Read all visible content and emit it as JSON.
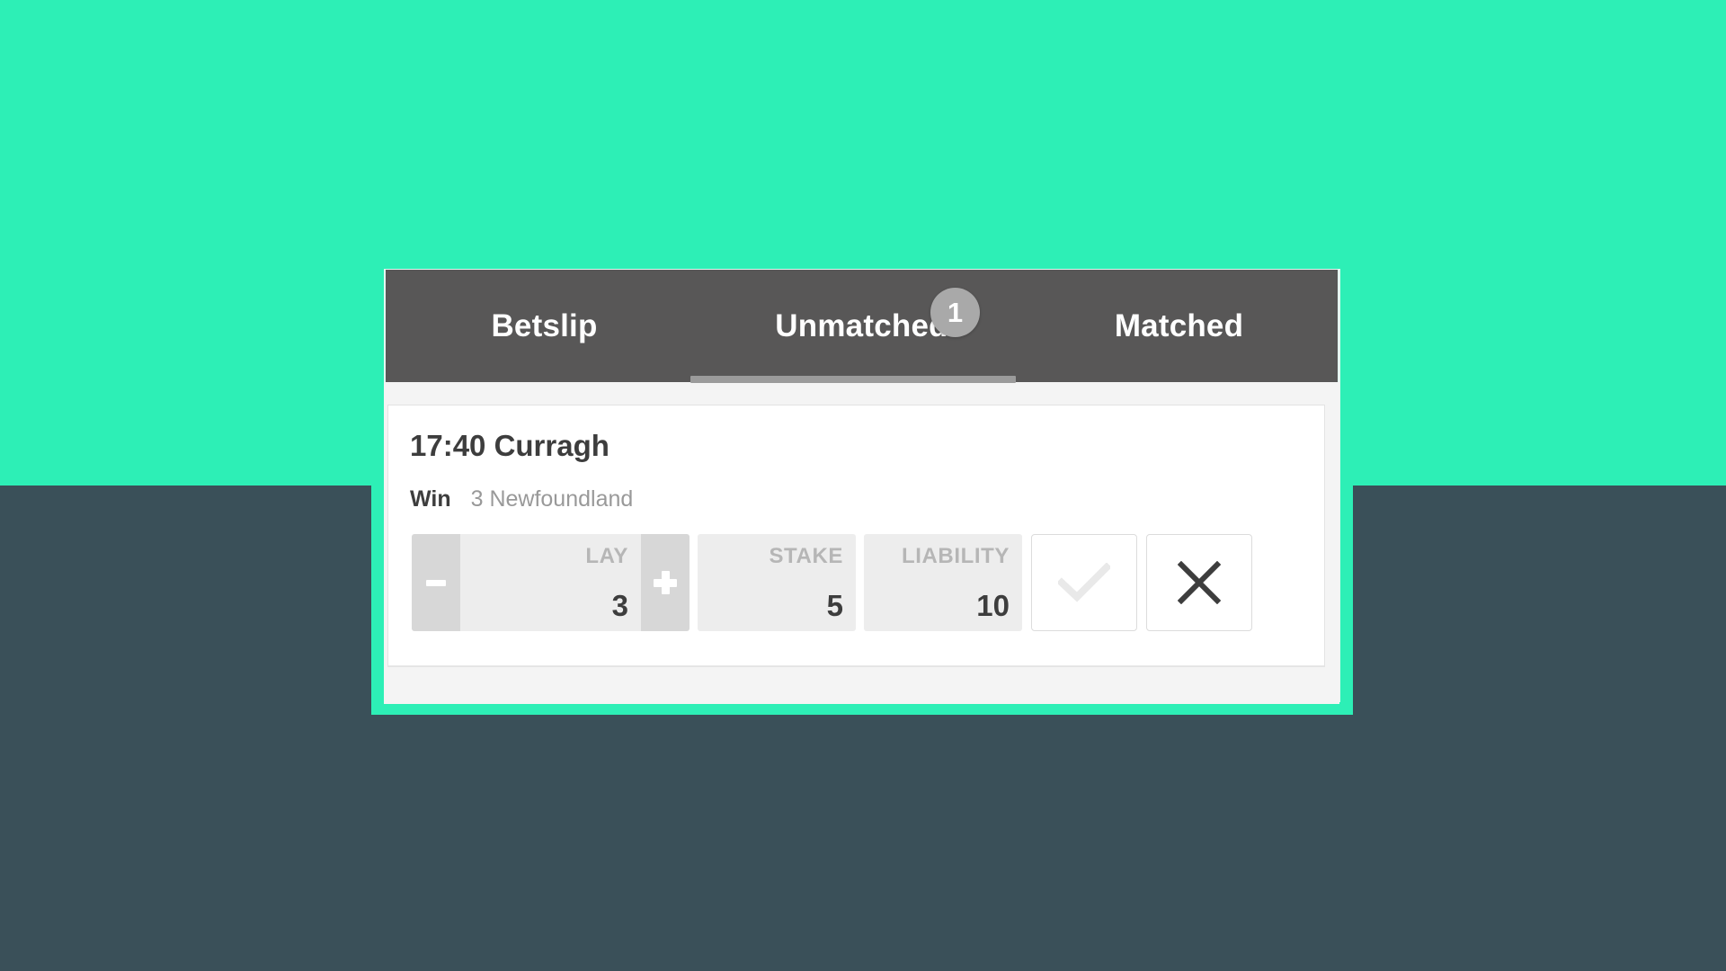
{
  "theme": {
    "background_top": "#2defb6",
    "background_bottom": "#3a5059",
    "frame_accent": "#2defb6",
    "tabbar_background": "#585757",
    "badge_background": "#a9a9a9",
    "value_text": "#3d3d3d",
    "label_text": "#b6b6b6",
    "muted_text": "#999999"
  },
  "betslip": {
    "tabs": [
      {
        "id": "betslip",
        "label": "Betslip",
        "active": false,
        "badge": null
      },
      {
        "id": "unmatched",
        "label": "Unmatched",
        "active": true,
        "badge": "1"
      },
      {
        "id": "matched",
        "label": "Matched",
        "active": false,
        "badge": null
      }
    ],
    "bets": [
      {
        "event": "17:40 Curragh",
        "market": "Win",
        "runner": "3 Newfoundland",
        "decrement_label": "-",
        "increment_label": "+",
        "fields": [
          {
            "id": "lay",
            "label": "LAY",
            "value": "3"
          },
          {
            "id": "stake",
            "label": "STAKE",
            "value": "5"
          },
          {
            "id": "liability",
            "label": "LIABILITY",
            "value": "10"
          }
        ],
        "actions": [
          {
            "id": "confirm",
            "icon": "check-icon",
            "enabled": false
          },
          {
            "id": "cancel",
            "icon": "close-icon",
            "enabled": true
          }
        ]
      }
    ]
  }
}
